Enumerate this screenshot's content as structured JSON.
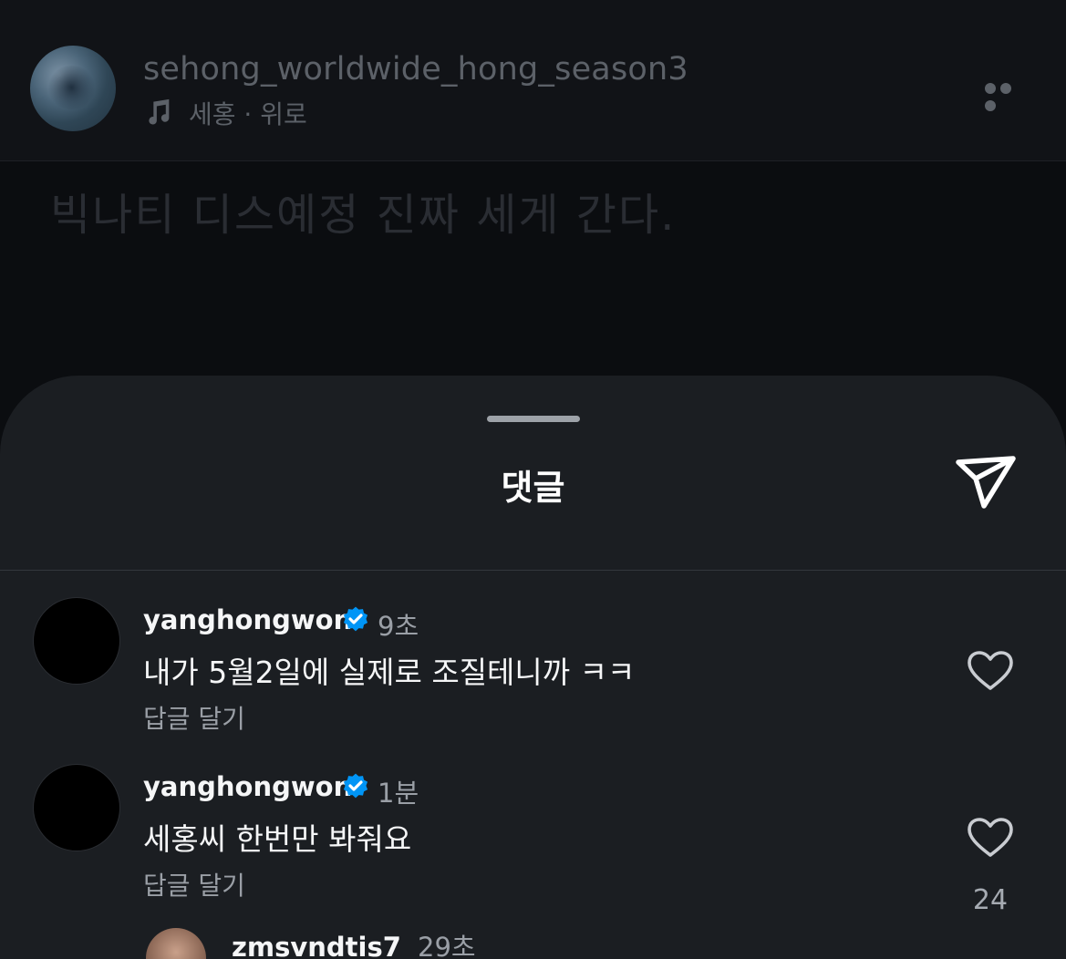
{
  "post": {
    "username": "sehong_worldwide_hong_season3",
    "subtitle": "세홍 · 위로",
    "text": "빅나티 디스예정 진짜 세게 간다."
  },
  "sheet": {
    "title": "댓글"
  },
  "comments": [
    {
      "username": "yanghongwon",
      "time": "9초",
      "text": "내가 5월2일에 실제로 조질테니까 ㅋㅋ",
      "reply_label": "답글 달기",
      "likes": ""
    },
    {
      "username": "yanghongwon",
      "time": "1분",
      "text": "세홍씨 한번만 봐줘요",
      "reply_label": "답글 달기",
      "likes": "24"
    }
  ],
  "partial_comment": {
    "username": "zmsvndtis7",
    "time": "29초"
  },
  "colors": {
    "verified_badge": "#0095f6",
    "sheet_bg": "#1b1e22",
    "background": "#0b0d10"
  },
  "icons": [
    "music-note-icon",
    "more-icon",
    "share-icon",
    "verified-icon",
    "heart-icon"
  ]
}
